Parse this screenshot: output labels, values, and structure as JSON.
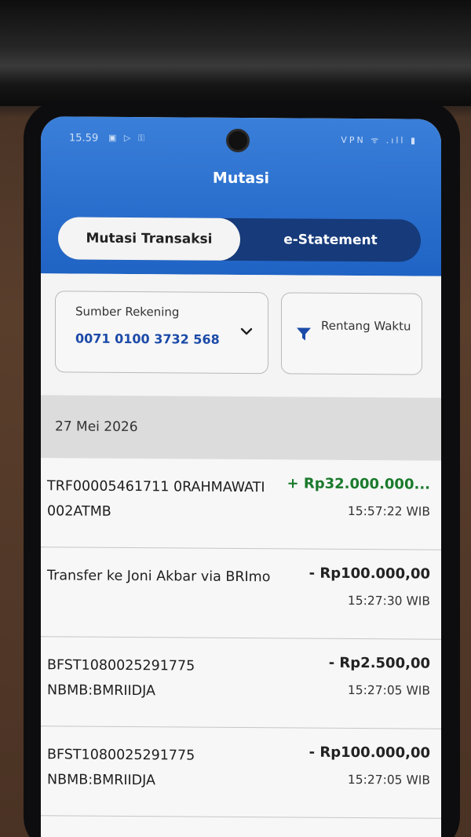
{
  "status_bar": {
    "time": "15.59",
    "left_icons": "▣ ▷ ⚿",
    "right_icons": "VPN ᯤ .ıll ▮"
  },
  "app": {
    "title": "Mutasi"
  },
  "tabs": [
    {
      "label": "Mutasi Transaksi",
      "active": true
    },
    {
      "label": "e-Statement",
      "active": false
    }
  ],
  "source_account": {
    "label": "Sumber Rekening",
    "value": "0071 0100 3732 568",
    "icon": "chevron-down-icon"
  },
  "date_range": {
    "label": "Rentang Waktu",
    "icon": "filter-icon"
  },
  "date_group": "27 Mei 2026",
  "transactions": [
    {
      "description": "TRF00005461711 0RAHMAWATI 002ATMB",
      "amount": "+ Rp32.000.000...",
      "time": "15:57:22 WIB",
      "type": "credit"
    },
    {
      "description": "Transfer ke Joni Akbar via BRImo",
      "amount": "- Rp100.000,00",
      "time": "15:27:30 WIB",
      "type": "debit"
    },
    {
      "description": "BFST1080025291775 NBMB:BMRIIDJA",
      "amount": "- Rp2.500,00",
      "time": "15:27:05 WIB",
      "type": "debit"
    },
    {
      "description": "BFST1080025291775 NBMB:BMRIIDJA",
      "amount": "- Rp100.000,00",
      "time": "15:27:05 WIB",
      "type": "debit"
    }
  ],
  "colors": {
    "header_blue": "#1f63c4",
    "tab_bar": "#163a7a",
    "credit_green": "#1a7a2c",
    "account_blue": "#1b4aa8"
  }
}
